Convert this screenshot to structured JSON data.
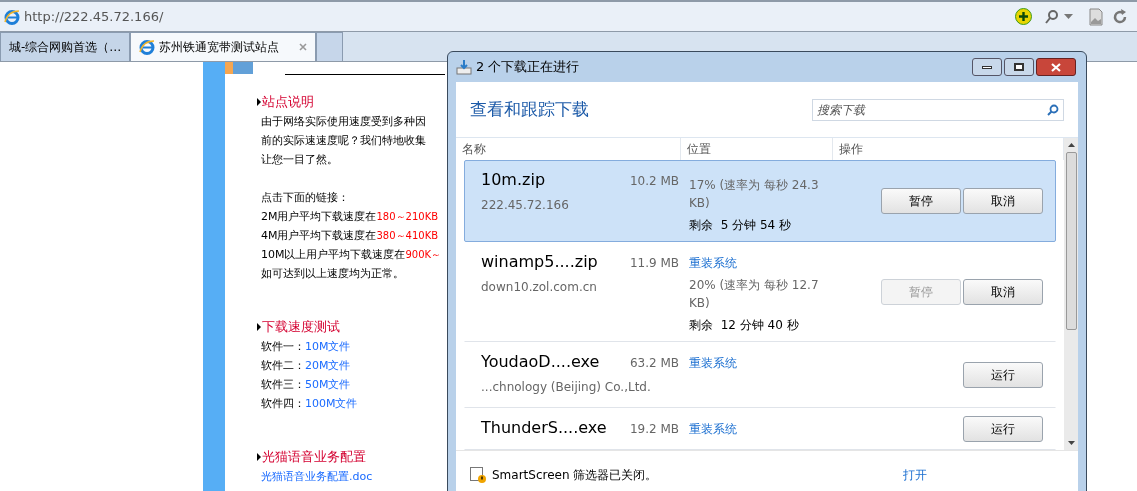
{
  "browser": {
    "address": "http://222.45.72.166/",
    "tabs": [
      {
        "label": "城-综合网购首选（…",
        "selected": false
      },
      {
        "label": "苏州铁通宽带测试站点",
        "selected": true
      }
    ]
  },
  "page": {
    "sections": [
      {
        "title": "站点说明",
        "paragraphs": [
          [
            {
              "parts": [
                {
                  "text": "由于网络实际使用速度受到多种因",
                  "kind": "plain"
                }
              ]
            },
            {
              "parts": [
                {
                  "text": "前的实际速速度呢？我们特地收集",
                  "kind": "plain"
                }
              ]
            },
            {
              "parts": [
                {
                  "text": "让您一目了然。",
                  "kind": "plain"
                }
              ]
            }
          ],
          [
            {
              "parts": [
                {
                  "text": "点击下面的链接：",
                  "kind": "plain"
                }
              ]
            },
            {
              "parts": [
                {
                  "text": "2M用户平均下载速度在",
                  "kind": "plain"
                },
                {
                  "text": "180～210KB",
                  "kind": "red"
                }
              ]
            },
            {
              "parts": [
                {
                  "text": "4M用户平均下载速度在",
                  "kind": "plain"
                },
                {
                  "text": "380～410KB",
                  "kind": "red"
                }
              ]
            },
            {
              "parts": [
                {
                  "text": "10M以上用户平均下载速度在",
                  "kind": "plain"
                },
                {
                  "text": "900K～",
                  "kind": "red"
                }
              ]
            },
            {
              "parts": [
                {
                  "text": "如可达到以上速度均为正常。",
                  "kind": "plain"
                }
              ]
            }
          ]
        ]
      },
      {
        "title": "下载速度测试",
        "paragraphs": [
          [
            {
              "parts": [
                {
                  "text": "软件一：",
                  "kind": "plain"
                },
                {
                  "text": "10M文件",
                  "kind": "link"
                }
              ]
            },
            {
              "parts": [
                {
                  "text": "软件二：",
                  "kind": "plain"
                },
                {
                  "text": "20M文件",
                  "kind": "link"
                }
              ]
            },
            {
              "parts": [
                {
                  "text": "软件三：",
                  "kind": "plain"
                },
                {
                  "text": "50M文件",
                  "kind": "link"
                }
              ]
            },
            {
              "parts": [
                {
                  "text": "软件四：",
                  "kind": "plain"
                },
                {
                  "text": "100M文件",
                  "kind": "link"
                }
              ]
            }
          ]
        ]
      },
      {
        "title": "光猫语音业务配置",
        "paragraphs": [
          [
            {
              "parts": [
                {
                  "text": "光猫语音业务配置.doc",
                  "kind": "link"
                }
              ]
            }
          ]
        ]
      }
    ]
  },
  "dialog": {
    "title": "2 个下载正在进行",
    "heading": "查看和跟踪下载",
    "search": {
      "placeholder": "搜索下载"
    },
    "columns": [
      "名称",
      "位置",
      "操作"
    ],
    "downloads": [
      {
        "name": "10m.zip",
        "size": "10.2 MB",
        "source": "222.45.72.166",
        "progress": "17% (速率为 每秒 24.3 KB)",
        "remaining": "剩余  5 分钟 54 秒",
        "selected": true,
        "buttons": [
          {
            "label": "暂停",
            "disabled": false
          },
          {
            "label": "取消",
            "disabled": false
          }
        ]
      },
      {
        "name": "winamp5....zip",
        "size": "11.9 MB",
        "source": "down10.zol.com.cn",
        "location": "重装系统",
        "progress": "20% (速率为 每秒 12.7 KB)",
        "remaining": "剩余  12 分钟 40 秒",
        "selected": false,
        "buttons": [
          {
            "label": "暂停",
            "disabled": true
          },
          {
            "label": "取消",
            "disabled": false
          }
        ]
      },
      {
        "name": "YoudaoD....exe",
        "size": "63.2 MB",
        "source": "...chnology (Beijing) Co.,Ltd.",
        "location": "重装系统",
        "selected": false,
        "buttons": [
          {
            "label": "运行",
            "disabled": false
          }
        ]
      },
      {
        "name": "ThunderS....exe",
        "size": "19.2 MB",
        "location": "重装系统",
        "selected": false,
        "buttons": [
          {
            "label": "运行",
            "disabled": false
          }
        ]
      }
    ],
    "smartscreen": {
      "message": "SmartScreen 筛选器已关闭。",
      "action": "打开"
    }
  }
}
